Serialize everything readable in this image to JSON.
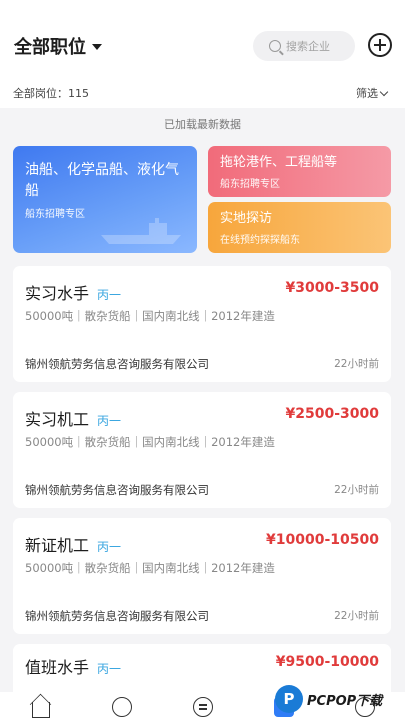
{
  "header": {
    "title": "全部职位",
    "search_placeholder": "搜索企业",
    "count_label": "全部岗位：115",
    "filter_label": "筛选"
  },
  "status": {
    "loaded_text": "已加载最新数据"
  },
  "banners": [
    {
      "title": "油船、化学品船、液化气船",
      "subtitle": "船东招聘专区"
    },
    {
      "title": "拖轮港作、工程船等",
      "subtitle": "船东招聘专区"
    },
    {
      "title": "实地探访",
      "subtitle": "在线预约探探船东"
    }
  ],
  "jobs": [
    {
      "title": "实习水手",
      "grade": "丙一",
      "salary": "¥3000-3500",
      "meta": "50000吨｜散杂货船｜国内南北线｜2012年建造",
      "company": "锦州领航劳务信息咨询服务有限公司",
      "time": "22小时前"
    },
    {
      "title": "实习机工",
      "grade": "丙一",
      "salary": "¥2500-3000",
      "meta": "50000吨｜散杂货船｜国内南北线｜2012年建造",
      "company": "锦州领航劳务信息咨询服务有限公司",
      "time": "22小时前"
    },
    {
      "title": "新证机工",
      "grade": "丙一",
      "salary": "¥10000-10500",
      "meta": "50000吨｜散杂货船｜国内南北线｜2012年建造",
      "company": "锦州领航劳务信息咨询服务有限公司",
      "time": "22小时前"
    },
    {
      "title": "值班水手",
      "grade": "丙一",
      "salary": "¥9500-10000"
    }
  ],
  "tabbar": {
    "tabs": [
      "home-icon",
      "ship-wheel-icon",
      "message-icon",
      "briefcase-icon",
      "profile-icon"
    ]
  },
  "watermark": {
    "logo_letter": "P",
    "text": "PCPOP下载"
  },
  "colors": {
    "salary": "#e03b3b",
    "grade": "#3aa6e0",
    "accent": "#2f7cf6"
  }
}
